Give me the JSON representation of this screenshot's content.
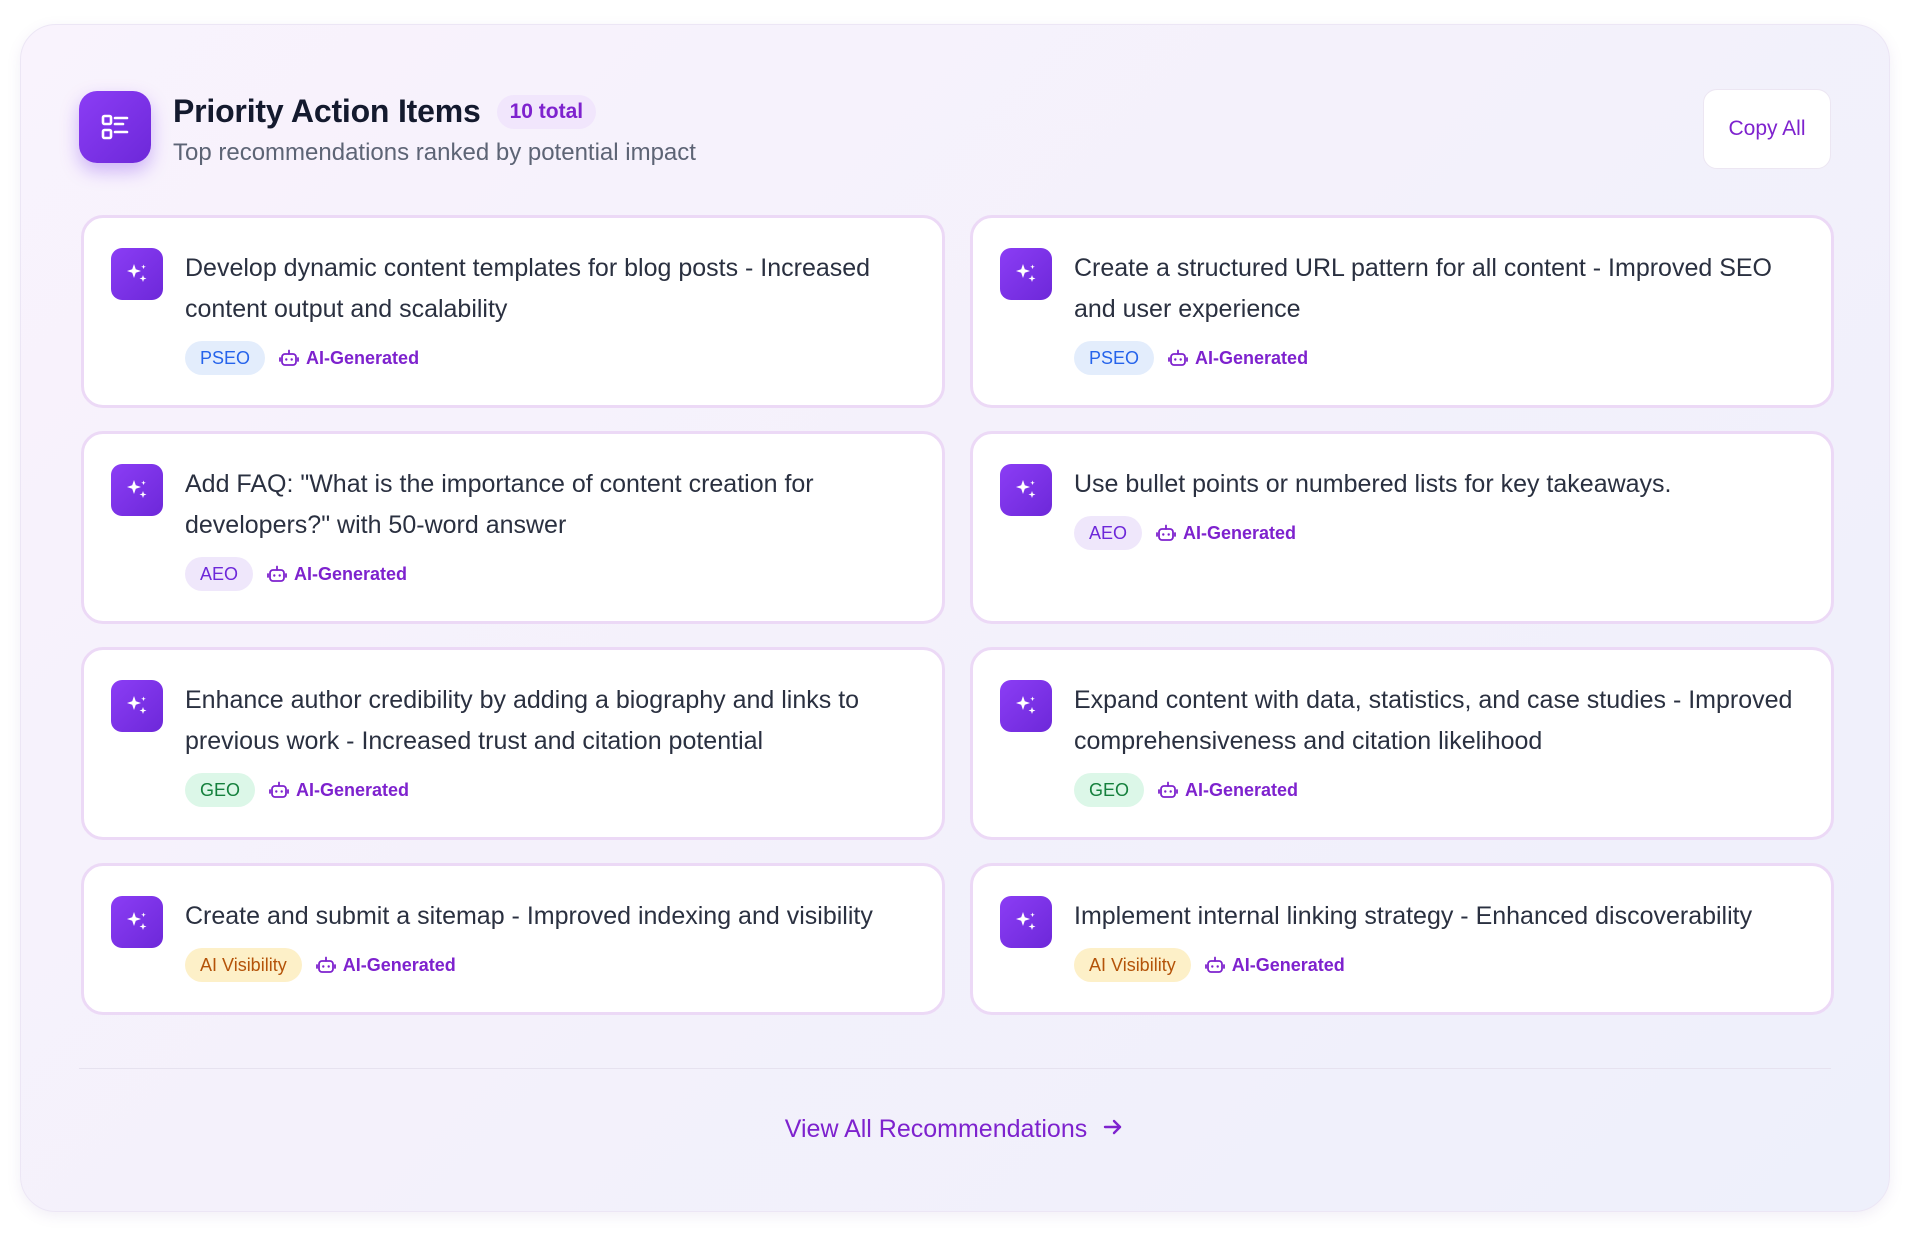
{
  "header": {
    "title": "Priority Action Items",
    "total_badge": "10 total",
    "subtitle": "Top recommendations ranked by potential impact",
    "copy_button": "Copy All",
    "icon": "list-icon"
  },
  "items": [
    {
      "text": "Develop dynamic content templates for blog posts - Increased content output and scalability",
      "tag": "PSEO",
      "tag_color": "#2563eb",
      "source": "AI-Generated"
    },
    {
      "text": "Create a structured URL pattern for all content - Improved SEO and user experience",
      "tag": "PSEO",
      "tag_color": "#2563eb",
      "source": "AI-Generated"
    },
    {
      "text": "Add FAQ: \"What is the importance of content creation for developers?\" with 50-word answer",
      "tag": "AEO",
      "tag_color": "#6d28d9",
      "source": "AI-Generated"
    },
    {
      "text": "Use bullet points or numbered lists for key takeaways.",
      "tag": "AEO",
      "tag_color": "#6d28d9",
      "source": "AI-Generated"
    },
    {
      "text": "Enhance author credibility by adding a biography and links to previous work - Increased trust and citation potential",
      "tag": "GEO",
      "tag_color": "#15803d",
      "source": "AI-Generated"
    },
    {
      "text": "Expand content with data, statistics, and case studies - Improved comprehensiveness and citation likelihood",
      "tag": "GEO",
      "tag_color": "#15803d",
      "source": "AI-Generated"
    },
    {
      "text": "Create and submit a sitemap - Improved indexing and visibility",
      "tag": "AI Visibility",
      "tag_color": "#b45309",
      "source": "AI-Generated"
    },
    {
      "text": "Implement internal linking strategy - Enhanced discoverability",
      "tag": "AI Visibility",
      "tag_color": "#b45309",
      "source": "AI-Generated"
    }
  ],
  "footer": {
    "view_all_label": "View All Recommendations",
    "arrow_icon": "arrow-right-icon"
  },
  "colors": {
    "accent": "#7e22ce",
    "icon_gradient_start": "#8b3df5",
    "icon_gradient_end": "#6d28d9"
  }
}
